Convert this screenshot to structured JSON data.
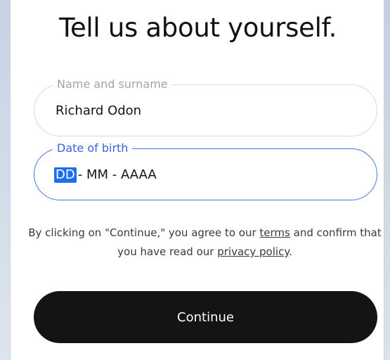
{
  "page": {
    "title": "Tell us about yourself."
  },
  "form": {
    "name_field": {
      "label": "Name and surname",
      "value": "Richard Odon"
    },
    "dob_field": {
      "label": "Date of birth",
      "segment_day": "DD",
      "segment_rest": "- MM - AAAA"
    }
  },
  "consent": {
    "part1": "By clicking on \"Continue,\" you agree to our ",
    "terms_link": "terms",
    "part2": " and confirm that you have read our ",
    "privacy_link": "privacy policy",
    "part3": "."
  },
  "actions": {
    "continue_label": "Continue"
  },
  "colors": {
    "accent_blue": "#3a64e0",
    "selection_blue": "#1e6ef2",
    "button_dark": "#141414"
  }
}
